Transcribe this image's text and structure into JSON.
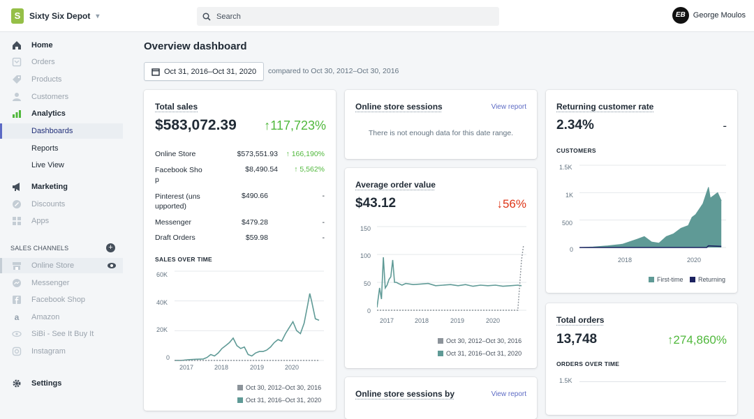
{
  "topbar": {
    "store_name": "Sixty Six Depot",
    "store_caret": "▾",
    "search_placeholder": "Search",
    "user_initials": "EB",
    "user_name": "George Moulos"
  },
  "sidebar": {
    "items": [
      {
        "label": "Home",
        "icon": "home-icon"
      },
      {
        "label": "Orders",
        "icon": "orders-icon"
      },
      {
        "label": "Products",
        "icon": "tag-icon"
      },
      {
        "label": "Customers",
        "icon": "person-icon"
      },
      {
        "label": "Analytics",
        "icon": "bar-chart-icon"
      },
      {
        "label": "Dashboards"
      },
      {
        "label": "Reports"
      },
      {
        "label": "Live View"
      },
      {
        "label": "Marketing",
        "icon": "megaphone-icon"
      },
      {
        "label": "Discounts",
        "icon": "discount-icon"
      },
      {
        "label": "Apps",
        "icon": "apps-icon"
      }
    ],
    "sales_channels_heading": "SALES CHANNELS",
    "channels": [
      {
        "label": "Online Store",
        "icon": "store-icon"
      },
      {
        "label": "Messenger",
        "icon": "messenger-icon"
      },
      {
        "label": "Facebook Shop",
        "icon": "facebook-icon"
      },
      {
        "label": "Amazon",
        "icon": "amazon-icon"
      },
      {
        "label": "SiBi - See It Buy It",
        "icon": "eye-icon"
      },
      {
        "label": "Instagram",
        "icon": "instagram-icon"
      }
    ],
    "settings_label": "Settings"
  },
  "header": {
    "title": "Overview dashboard",
    "date_range": "Oct 31, 2016–Oct 31, 2020",
    "compare_text": "compared to Oct 30, 2012–Oct 30, 2016"
  },
  "colors": {
    "accent": "#5c6ac4",
    "series": "#5f9a96",
    "positive": "#50b83c",
    "negative": "#de3618",
    "returning": "#1c2260"
  },
  "total_sales": {
    "title": "Total sales",
    "value": "$583,072.39",
    "change": "↑117,723%",
    "rows": [
      {
        "name": "Online Store",
        "amount": "$573,551.93",
        "change": "↑ 166,190%"
      },
      {
        "name": "Facebook Sho\np",
        "amount": "$8,490.54",
        "change": "↑ 5,562%"
      },
      {
        "name": "Pinterest (uns\nupported)",
        "amount": "$490.66",
        "change": "-"
      },
      {
        "name": "Messenger",
        "amount": "$479.28",
        "change": "-"
      },
      {
        "name": "Draft Orders",
        "amount": "$59.98",
        "change": "-"
      }
    ],
    "chart_label": "SALES OVER TIME",
    "legend": [
      "Oct 30, 2012–Oct 30, 2016",
      "Oct 31, 2016–Oct 31, 2020"
    ]
  },
  "sessions": {
    "title": "Online store sessions",
    "link": "View report",
    "message": "There is not enough data for this date range."
  },
  "aov": {
    "title": "Average order value",
    "value": "$43.12",
    "change": "↓56%",
    "legend": [
      "Oct 30, 2012–Oct 30, 2016",
      "Oct 31, 2016–Oct 31, 2020"
    ]
  },
  "returning": {
    "title": "Returning customer rate",
    "value": "2.34%",
    "change": "-",
    "chart_label": "CUSTOMERS",
    "legend": [
      "First-time",
      "Returning"
    ]
  },
  "total_orders": {
    "title": "Total orders",
    "value": "13,748",
    "change": "↑274,860%",
    "chart_label": "ORDERS OVER TIME",
    "tick": "1.5K"
  },
  "sessions_by": {
    "title": "Online store sessions by",
    "link": "View report"
  },
  "chart_data": [
    {
      "id": "sales-over-time",
      "type": "line",
      "x_ticks": [
        "2017",
        "2018",
        "2019",
        "2020"
      ],
      "y_ticks": [
        "60K",
        "40K",
        "20K",
        "0"
      ],
      "ylim": [
        0,
        60000
      ],
      "xlim": [
        2016.83,
        2020.83
      ],
      "series": [
        {
          "name": "Oct 31, 2016–Oct 31, 2020",
          "x": [
            2016.83,
            2017.0,
            2017.2,
            2017.4,
            2017.6,
            2017.7,
            2017.8,
            2017.9,
            2018.0,
            2018.1,
            2018.2,
            2018.3,
            2018.4,
            2018.5,
            2018.6,
            2018.7,
            2018.8,
            2018.9,
            2019.0,
            2019.1,
            2019.2,
            2019.3,
            2019.4,
            2019.5,
            2019.6,
            2019.7,
            2019.8,
            2019.9,
            2020.0,
            2020.1,
            2020.2,
            2020.3,
            2020.4,
            2020.45,
            2020.5,
            2020.6,
            2020.7
          ],
          "values": [
            0,
            0,
            500,
            800,
            1000,
            2000,
            4000,
            3000,
            5000,
            8000,
            10000,
            12000,
            15000,
            10000,
            8000,
            9000,
            4000,
            3000,
            5000,
            6000,
            6000,
            7000,
            9000,
            12000,
            14000,
            13000,
            18000,
            22000,
            26000,
            20000,
            18000,
            25000,
            38000,
            45000,
            40000,
            28000,
            27000
          ]
        },
        {
          "name": "Oct 30, 2012–Oct 30, 2016",
          "x": [
            2016.83,
            2020.7
          ],
          "values": [
            0,
            0
          ]
        }
      ]
    },
    {
      "id": "average-order-value",
      "type": "line",
      "x_ticks": [
        "2017",
        "2018",
        "2019",
        "2020"
      ],
      "y_ticks": [
        "150",
        "100",
        "50",
        "0"
      ],
      "ylim": [
        0,
        150
      ],
      "xlim": [
        2016.83,
        2020.83
      ],
      "series": [
        {
          "name": "Oct 31, 2016–Oct 31, 2020",
          "x": [
            2016.83,
            2016.9,
            2016.95,
            2017.0,
            2017.05,
            2017.1,
            2017.15,
            2017.2,
            2017.25,
            2017.3,
            2017.35,
            2017.4,
            2017.5,
            2017.6,
            2017.8,
            2018.0,
            2018.2,
            2018.4,
            2018.6,
            2018.8,
            2019.0,
            2019.2,
            2019.4,
            2019.6,
            2019.8,
            2020.0,
            2020.2,
            2020.4,
            2020.6,
            2020.7
          ],
          "values": [
            5,
            40,
            20,
            95,
            40,
            45,
            55,
            60,
            90,
            50,
            50,
            48,
            45,
            48,
            46,
            47,
            48,
            44,
            45,
            46,
            44,
            46,
            43,
            45,
            44,
            45,
            43,
            44,
            45,
            44
          ]
        },
        {
          "name": "Oct 30, 2012–Oct 30, 2016",
          "x": [
            2016.83,
            2017.0,
            2020.6,
            2020.7,
            2020.75
          ],
          "values": [
            0,
            0,
            0,
            90,
            115
          ]
        }
      ]
    },
    {
      "id": "customers",
      "type": "area",
      "x_ticks": [
        "2018",
        "2020"
      ],
      "y_ticks": [
        "1.5K",
        "1K",
        "500",
        "0"
      ],
      "ylim": [
        0,
        1500
      ],
      "xlim": [
        2016.83,
        2020.83
      ],
      "series": [
        {
          "name": "First-time",
          "x": [
            2016.83,
            2017.2,
            2017.6,
            2018.0,
            2018.4,
            2018.6,
            2018.8,
            2019.0,
            2019.2,
            2019.4,
            2019.6,
            2019.8,
            2019.9,
            2020.0,
            2020.1,
            2020.2,
            2020.3,
            2020.35,
            2020.4,
            2020.5,
            2020.6,
            2020.7
          ],
          "values": [
            0,
            10,
            30,
            60,
            150,
            200,
            100,
            80,
            200,
            250,
            350,
            400,
            550,
            600,
            700,
            800,
            1000,
            1100,
            900,
            950,
            1000,
            850
          ]
        },
        {
          "name": "Returning",
          "x": [
            2016.83,
            2020.3,
            2020.35,
            2020.7
          ],
          "values": [
            0,
            0,
            30,
            20
          ]
        }
      ]
    }
  ]
}
